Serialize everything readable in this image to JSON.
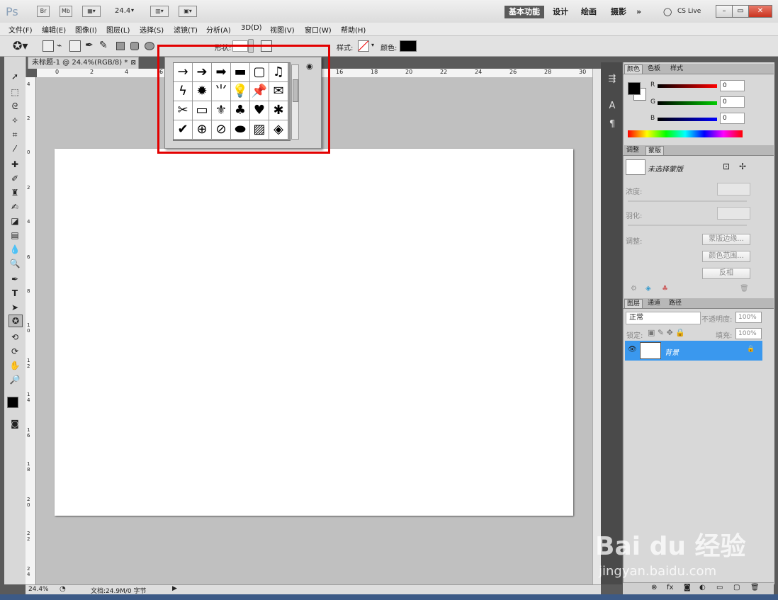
{
  "app": {
    "logo": "Ps",
    "bridge": "Br",
    "mini_bridge": "Mb",
    "zoom_value": "24.4",
    "cs_live": "CS Live"
  },
  "workspaces": [
    "基本功能",
    "设计",
    "绘画",
    "摄影"
  ],
  "menus": [
    "文件(F)",
    "编辑(E)",
    "图像(I)",
    "图层(L)",
    "选择(S)",
    "滤镜(T)",
    "分析(A)",
    "3D(D)",
    "视图(V)",
    "窗口(W)",
    "帮助(H)"
  ],
  "options": {
    "shape_label": "形状:",
    "style_label": "样式:",
    "color_label": "颜色:"
  },
  "document": {
    "tab_title": "未标题-1 @ 24.4%(RGB/8) *",
    "zoom": "24.4%",
    "doc_size": "文档:24.9M/0 字节"
  },
  "ruler_h": [
    "0",
    "2",
    "4",
    "6",
    "16",
    "18",
    "20",
    "22",
    "24",
    "26",
    "28",
    "30"
  ],
  "ruler_v": [
    "4",
    "2",
    "0",
    "2",
    "4",
    "6",
    "8",
    "1 0",
    "1 2",
    "1 4",
    "1 6",
    "1 8",
    "2 0",
    "2 2",
    "2 4"
  ],
  "shapes": [
    "→",
    "➔",
    "➡",
    "▬",
    "▢",
    "♫",
    "ϟ",
    "✹",
    "⺌",
    "💡",
    "📌",
    "✉",
    "✂",
    "▭",
    "⚜",
    "♣",
    "♥",
    "✱",
    "✔",
    "⊕",
    "⊘",
    "⬬",
    "▨",
    "◈"
  ],
  "color_panel": {
    "tabs": [
      "颜色",
      "色板",
      "样式"
    ],
    "r_label": "R",
    "g_label": "G",
    "b_label": "B",
    "r_value": "0",
    "g_value": "0",
    "b_value": "0"
  },
  "masks_panel": {
    "tabs": [
      "调整",
      "蒙版"
    ],
    "title": "未选择蒙版",
    "density_label": "浓度:",
    "feather_label": "羽化:",
    "adjust_label": "调整:",
    "edge_button": "蒙版边缘...",
    "color_range_button": "颜色范围...",
    "invert_button": "反相"
  },
  "layers_panel": {
    "tabs": [
      "图层",
      "通道",
      "路径"
    ],
    "blend_mode": "正常",
    "opacity_label": "不透明度:",
    "opacity_value": "100%",
    "lock_label": "锁定:",
    "fill_label": "填充:",
    "fill_value": "100%",
    "layer_name": "背景"
  },
  "watermark": {
    "brand": "Bai du 经验",
    "url": "jingyan.baidu.com"
  },
  "colors": {
    "accent": "#3a98ee",
    "highlight": "#e30000"
  }
}
